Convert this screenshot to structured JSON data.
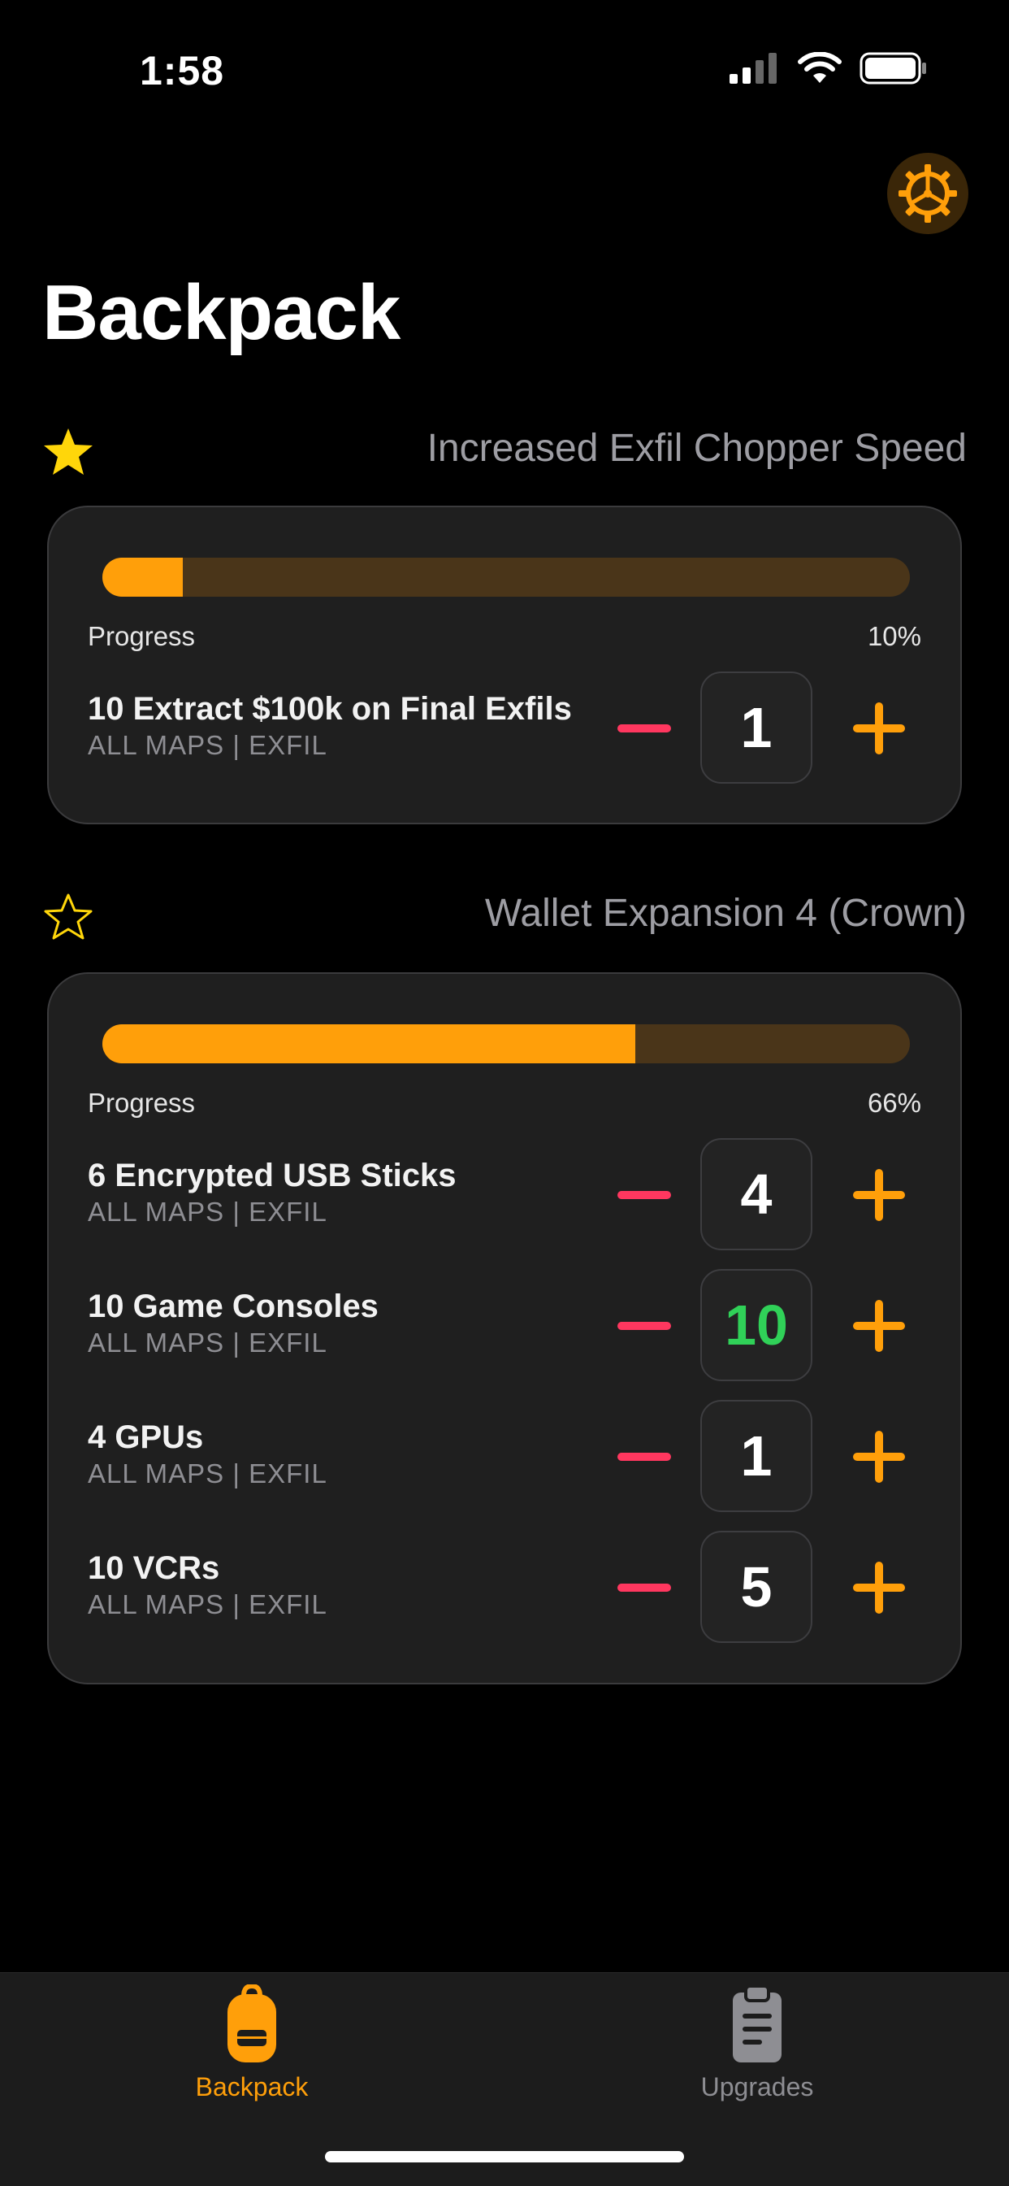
{
  "status_bar": {
    "time": "1:58"
  },
  "colors": {
    "accent": "#ff9f0a",
    "star": "#ffd60a",
    "minus": "#ff375f",
    "complete": "#30d158",
    "muted": "#8e8e93"
  },
  "page": {
    "title": "Backpack"
  },
  "sections": [
    {
      "name": "Increased Exfil Chopper Speed",
      "favorited": true,
      "progress_label": "Progress",
      "progress_fraction": 0.1,
      "progress_text": "10%",
      "tasks": [
        {
          "title": "10 Extract $100k on Final Exfils",
          "subtitle": "ALL MAPS | EXFIL",
          "count": "1",
          "complete": false
        }
      ]
    },
    {
      "name": "Wallet Expansion 4 (Crown)",
      "favorited": false,
      "progress_label": "Progress",
      "progress_fraction": 0.66,
      "progress_text": "66%",
      "tasks": [
        {
          "title": "6 Encrypted USB Sticks",
          "subtitle": "ALL MAPS | EXFIL",
          "count": "4",
          "complete": false
        },
        {
          "title": "10 Game Consoles",
          "subtitle": "ALL MAPS | EXFIL",
          "count": "10",
          "complete": true
        },
        {
          "title": "4 GPUs",
          "subtitle": "ALL MAPS | EXFIL",
          "count": "1",
          "complete": false
        },
        {
          "title": "10 VCRs",
          "subtitle": "ALL MAPS | EXFIL",
          "count": "5",
          "complete": false
        }
      ]
    }
  ],
  "tab_bar": {
    "tabs": [
      {
        "label": "Backpack",
        "icon": "backpack-icon",
        "active": true
      },
      {
        "label": "Upgrades",
        "icon": "clipboard-icon",
        "active": false
      }
    ]
  }
}
